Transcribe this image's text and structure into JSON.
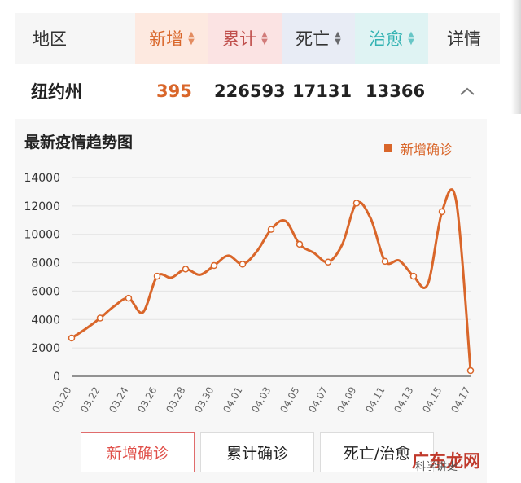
{
  "header": {
    "region": "地区",
    "new": "新增",
    "cumulative": "累计",
    "deaths": "死亡",
    "recovered": "治愈",
    "details": "详情"
  },
  "row": {
    "region": "纽约州",
    "new": "395",
    "cumulative": "226593",
    "deaths": "17131",
    "recovered": "13366"
  },
  "chart": {
    "title": "最新疫情趋势图",
    "legend": "新增确诊"
  },
  "chart_data": {
    "type": "line",
    "title": "最新疫情趋势图",
    "x": [
      "03.20",
      "03.21",
      "03.22",
      "03.23",
      "03.24",
      "03.25",
      "03.26",
      "03.27",
      "03.28",
      "03.29",
      "03.30",
      "03.31",
      "04.01",
      "04.02",
      "04.03",
      "04.04",
      "04.05",
      "04.06",
      "04.07",
      "04.08",
      "04.09",
      "04.10",
      "04.11",
      "04.12",
      "04.13",
      "04.14",
      "04.15",
      "04.16",
      "04.17"
    ],
    "x_tick_labels": [
      "03.20",
      "03.22",
      "03.24",
      "03.26",
      "03.28",
      "03.30",
      "04.01",
      "04.03",
      "04.05",
      "04.07",
      "04.09",
      "04.11",
      "04.13",
      "04.15",
      "04.17"
    ],
    "series": [
      {
        "name": "新增确诊",
        "values": [
          2700,
          3350,
          4100,
          4950,
          5500,
          4500,
          7050,
          6950,
          7550,
          7150,
          7800,
          8500,
          7900,
          8800,
          10350,
          10950,
          9300,
          8700,
          8050,
          9300,
          12200,
          11100,
          8100,
          8150,
          7050,
          6500,
          11600,
          12300,
          400
        ]
      }
    ],
    "ylim": [
      0,
      14000
    ],
    "yticks": [
      0,
      2000,
      4000,
      6000,
      8000,
      10000,
      12000,
      14000
    ],
    "grid": true,
    "color": "#d9662a"
  },
  "buttons": {
    "new_confirmed": "新增确诊",
    "cumulative_confirmed": "累计确诊",
    "deaths_recovered": "死亡/治愈"
  },
  "colors": {
    "new": "#d9662a",
    "cumulative": "#c0504d",
    "deaths": "#333333",
    "recovered": "#35b3b3"
  },
  "watermark": {
    "site": "广东龙网",
    "sub": "科学讲史"
  }
}
